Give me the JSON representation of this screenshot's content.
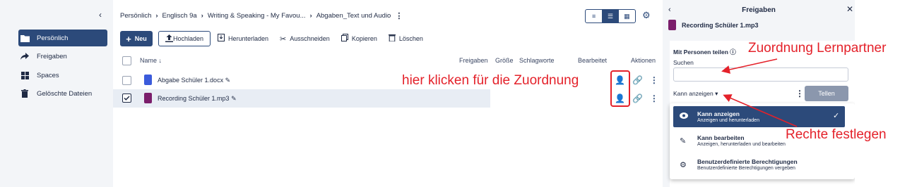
{
  "sidebar": {
    "collapse_icon": "chevron-left-icon",
    "items": [
      {
        "label": "Persönlich",
        "icon": "folder-icon"
      },
      {
        "label": "Freigaben",
        "icon": "share-arrow-icon"
      },
      {
        "label": "Spaces",
        "icon": "grid-icon"
      },
      {
        "label": "Gelöschte Dateien",
        "icon": "trash-icon"
      }
    ]
  },
  "breadcrumb": [
    "Persönlich",
    "Englisch 9a",
    "Writing & Speaking - My Favou...",
    "Abgaben_Text und Audio"
  ],
  "toolbar": {
    "new_label": "Neu",
    "upload_label": "Hochladen",
    "download_label": "Herunterladen",
    "cut_label": "Ausschneiden",
    "copy_label": "Kopieren",
    "delete_label": "Löschen"
  },
  "table": {
    "headers": {
      "name": "Name ↓",
      "shares": "Freigaben",
      "size": "Größe",
      "tags": "Schlagworte",
      "modified": "Bearbeitet",
      "actions": "Aktionen"
    },
    "rows": [
      {
        "name": "Abgabe Schüler 1.docx",
        "type": "docx",
        "selected": false
      },
      {
        "name": "Recording Schüler 1.mp3",
        "type": "mp3",
        "selected": true
      }
    ]
  },
  "annotations": {
    "click_hint": "hier klicken für die Zuordnung",
    "partner_hint": "Zuordnung Lernpartner",
    "rights_hint": "Rechte festlegen"
  },
  "panel": {
    "title": "Freigaben",
    "file_name": "Recording Schüler 1.mp3",
    "share_with_label": "Mit Personen teilen ⓘ",
    "search_label": "Suchen",
    "search_value": "",
    "permission_value": "Kann anzeigen ▾",
    "share_button": "Tellen",
    "options": [
      {
        "title": "Kann anzeigen",
        "desc": "Anzeigen und herunterladen",
        "icon": "eye-icon",
        "selected": true
      },
      {
        "title": "Kann bearbeiten",
        "desc": "Anzeigen, herunterladen und bearbeiten",
        "icon": "pencil-icon",
        "selected": false
      },
      {
        "title": "Benutzerdefinierte Berechtigungen",
        "desc": "Benutzerdefinierte Berechtigungen vergeben",
        "icon": "gear-icon",
        "selected": false
      }
    ]
  },
  "colors": {
    "primary": "#2c4a7a",
    "annotation": "#e4212a",
    "docx": "#3b5bdb",
    "mp3": "#7b1e6b"
  }
}
